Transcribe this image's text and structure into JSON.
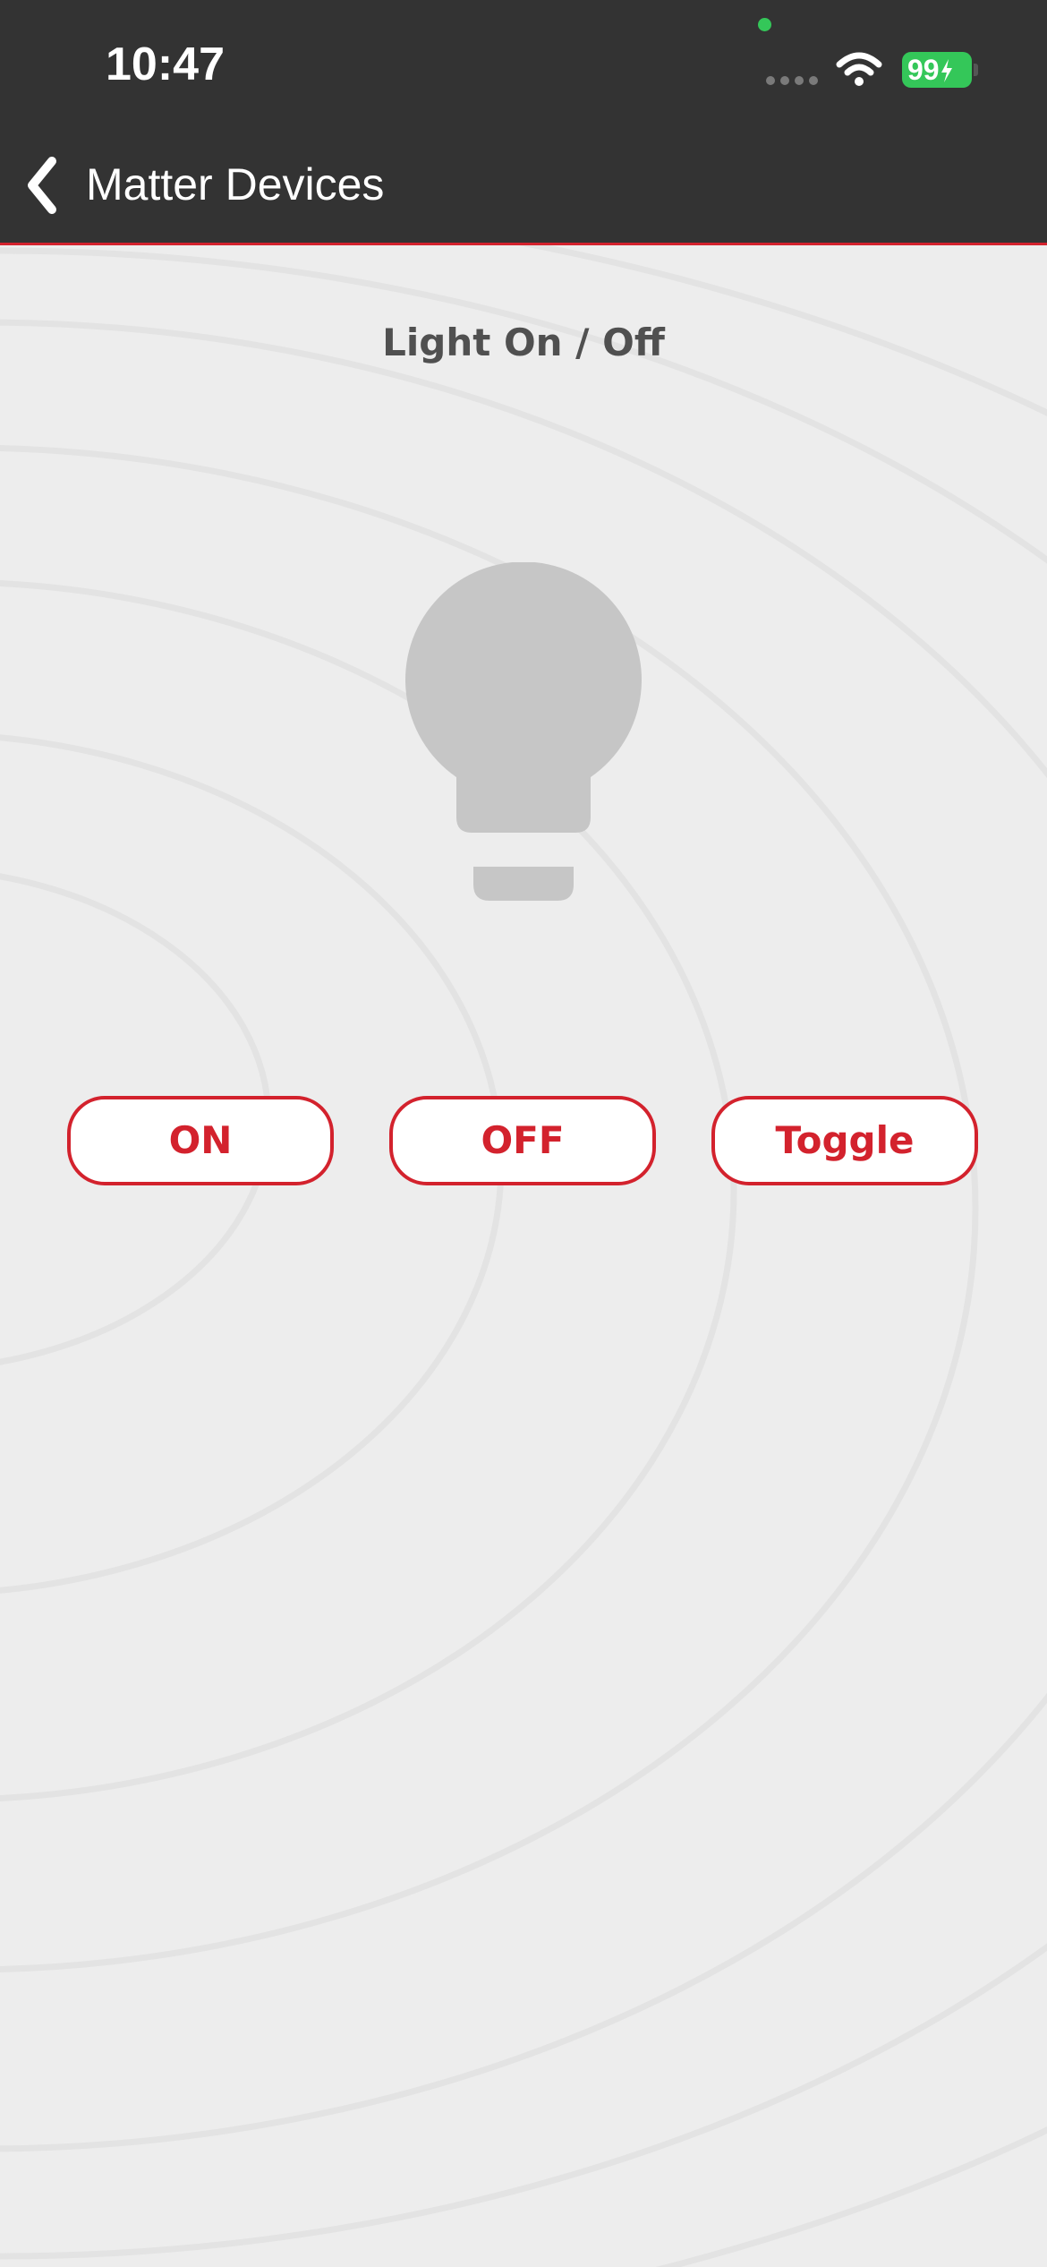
{
  "status_bar": {
    "time": "10:47",
    "battery": "99",
    "battery_color": "#34c759",
    "wifi_icon": "wifi-icon",
    "signal_icon": "cellular-signal-icon"
  },
  "nav": {
    "back_icon": "chevron-left-icon",
    "title": "Matter Devices",
    "bar_color": "#333333",
    "accent_color": "#d3222d"
  },
  "main": {
    "title": "Light On / Off",
    "bulb_icon": "light-bulb-icon",
    "bulb_color": "#c6c6c6",
    "buttons": [
      {
        "label": "ON"
      },
      {
        "label": "OFF"
      },
      {
        "label": "Toggle"
      }
    ]
  }
}
